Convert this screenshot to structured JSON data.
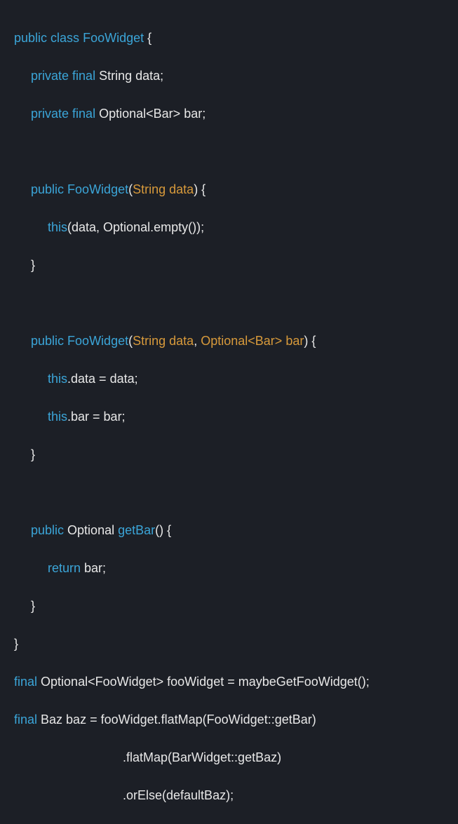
{
  "code": {
    "l1_public": "public",
    "l1_class": "class",
    "l1_name": "FooWidget",
    "l1_brace": "{",
    "l2_private": "private",
    "l2_final": "final",
    "l2_type": "String",
    "l2_field": "data;",
    "l3_private": "private",
    "l3_final": "final",
    "l3_type1": "Optional",
    "l3_lt": "<",
    "l3_type2": "Bar",
    "l3_gt": ">",
    "l3_field": "bar;",
    "l5_public": "public",
    "l5_name": "FooWidget",
    "l5_lparen": "(",
    "l5_ptype": "String",
    "l5_pname": "data",
    "l5_rparen_brace": ") {",
    "l6_this": "this",
    "l6_rest": "(data, Optional.empty());",
    "l7_brace": "}",
    "l9_public": "public",
    "l9_name": "FooWidget",
    "l9_lparen": "(",
    "l9_ptype1": "String",
    "l9_pname1": "data",
    "l9_comma": ", ",
    "l9_ptype2": "Optional",
    "l9_lt": "<",
    "l9_ptype3": "Bar",
    "l9_gt": ">",
    "l9_pname2": "bar",
    "l9_rparen_brace": ") {",
    "l10_this": "this",
    "l10_rest": ".data = data;",
    "l11_this": "this",
    "l11_rest": ".bar = bar;",
    "l12_brace": "}",
    "l14_public": "public",
    "l14_type": "Optional",
    "l14_method": "getBar",
    "l14_parens_brace": "() {",
    "l15_return": "return",
    "l15_val": " bar;",
    "l16_brace": "}",
    "l17_brace": "}",
    "l18_final": "final",
    "l18_type1": " Optional",
    "l18_lt": "<",
    "l18_type2": "FooWidget",
    "l18_gt": ">",
    "l18_rest": " fooWidget = maybeGetFooWidget();",
    "l19_final": "final",
    "l19_rest": " Baz baz = fooWidget.flatMap(FooWidget::getBar)",
    "l20": ".flatMap(BarWidget::getBaz)",
    "l21": ".orElse(defaultBaz);"
  }
}
